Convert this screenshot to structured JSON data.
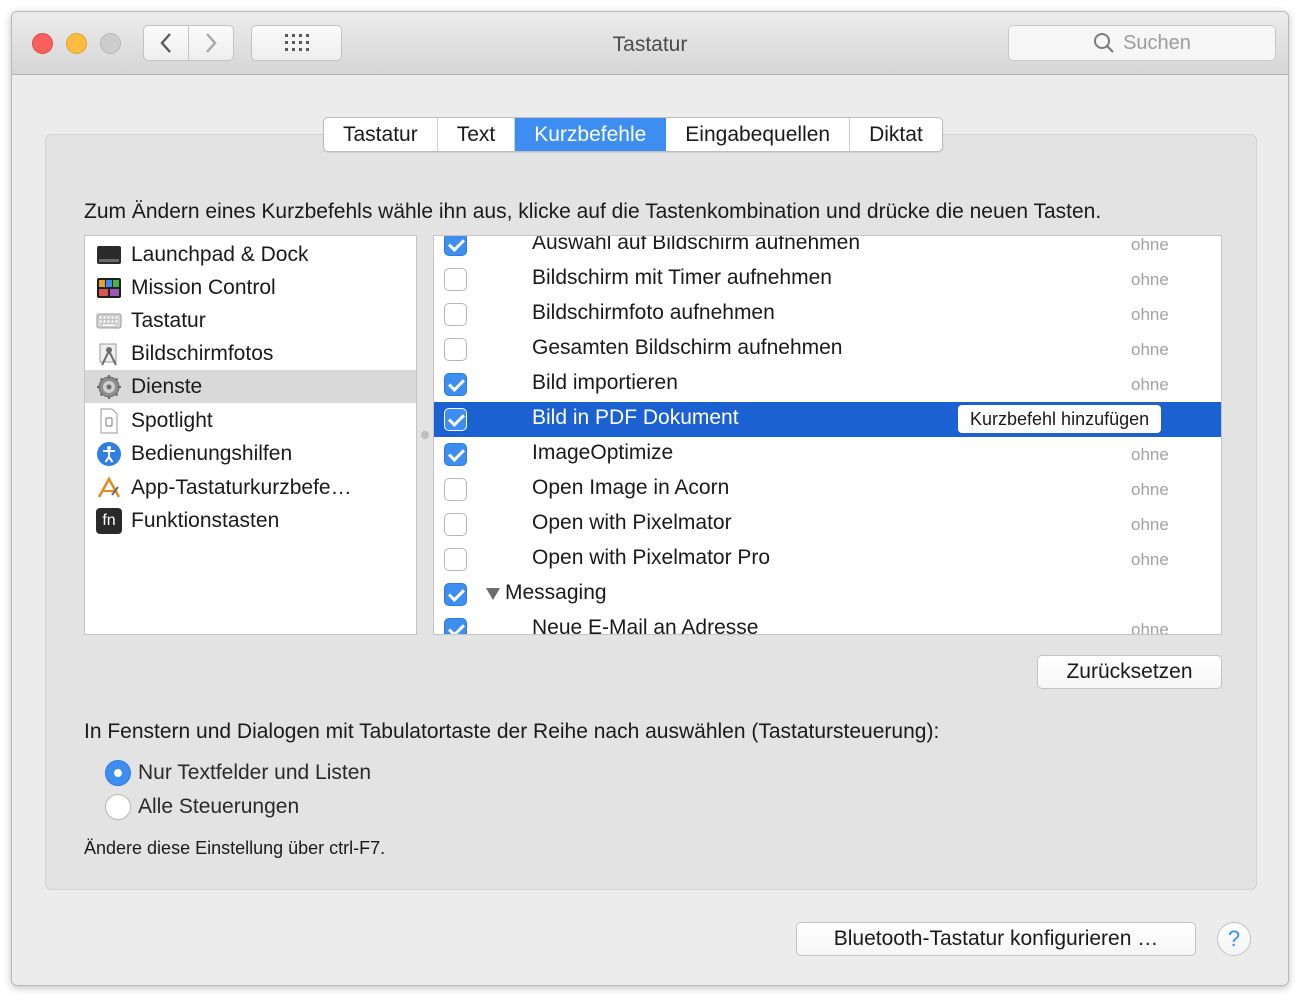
{
  "window": {
    "title": "Tastatur",
    "search_placeholder": "Suchen"
  },
  "tabs": [
    "Tastatur",
    "Text",
    "Kurzbefehle",
    "Eingabequellen",
    "Diktat"
  ],
  "active_tab": "Kurzbefehle",
  "instruction": "Zum Ändern eines Kurzbefehls wähle ihn aus, klicke auf die Tastenkombination und drücke die neuen Tasten.",
  "categories": [
    {
      "label": "Launchpad & Dock",
      "icon": "launchpad-dock-icon"
    },
    {
      "label": "Mission Control",
      "icon": "mission-control-icon"
    },
    {
      "label": "Tastatur",
      "icon": "keyboard-icon"
    },
    {
      "label": "Bildschirmfotos",
      "icon": "screenshot-icon"
    },
    {
      "label": "Dienste",
      "icon": "gear-icon",
      "selected": true
    },
    {
      "label": "Spotlight",
      "icon": "spotlight-icon"
    },
    {
      "label": "Bedienungshilfen",
      "icon": "accessibility-icon"
    },
    {
      "label": "App-Tastaturkurzbefe…",
      "icon": "app-shortcuts-icon"
    },
    {
      "label": "Funktionstasten",
      "icon": "fn-key-icon",
      "glyph": "fn"
    }
  ],
  "services": [
    {
      "name": "Auswahl auf Bildschirm aufnehmen",
      "checked": true,
      "shortcut": "ohne"
    },
    {
      "name": "Bildschirm mit Timer aufnehmen",
      "checked": false,
      "shortcut": "ohne"
    },
    {
      "name": "Bildschirmfoto aufnehmen",
      "checked": false,
      "shortcut": "ohne"
    },
    {
      "name": "Gesamten Bildschirm aufnehmen",
      "checked": false,
      "shortcut": "ohne"
    },
    {
      "name": "Bild importieren",
      "checked": true,
      "shortcut": "ohne"
    },
    {
      "name": "Bild in PDF Dokument",
      "checked": true,
      "shortcut": "",
      "selected": true,
      "action": "Kurzbefehl hinzufügen"
    },
    {
      "name": "ImageOptimize",
      "checked": true,
      "shortcut": "ohne"
    },
    {
      "name": "Open Image in Acorn",
      "checked": false,
      "shortcut": "ohne"
    },
    {
      "name": "Open with Pixelmator",
      "checked": false,
      "shortcut": "ohne"
    },
    {
      "name": "Open with Pixelmator Pro",
      "checked": false,
      "shortcut": "ohne"
    },
    {
      "name": "Messaging",
      "checked": true,
      "shortcut": "",
      "group": true
    },
    {
      "name": "Neue E-Mail an Adresse",
      "checked": true,
      "shortcut": "ohne"
    }
  ],
  "buttons": {
    "reset": "Zurücksetzen",
    "bluetooth": "Bluetooth-Tastatur konfigurieren …",
    "help": "?"
  },
  "tab_navigation": {
    "label": "In Fenstern und Dialogen mit Tabulatortaste der Reihe nach auswählen (Tastatursteuerung):",
    "options": [
      {
        "label": "Nur Textfelder und Listen",
        "selected": true
      },
      {
        "label": "Alle Steuerungen",
        "selected": false
      }
    ],
    "hint": "Ändere diese Einstellung über ctrl-F7."
  },
  "colors": {
    "accent": "#3d8ef0",
    "selection": "#1b61d1"
  }
}
